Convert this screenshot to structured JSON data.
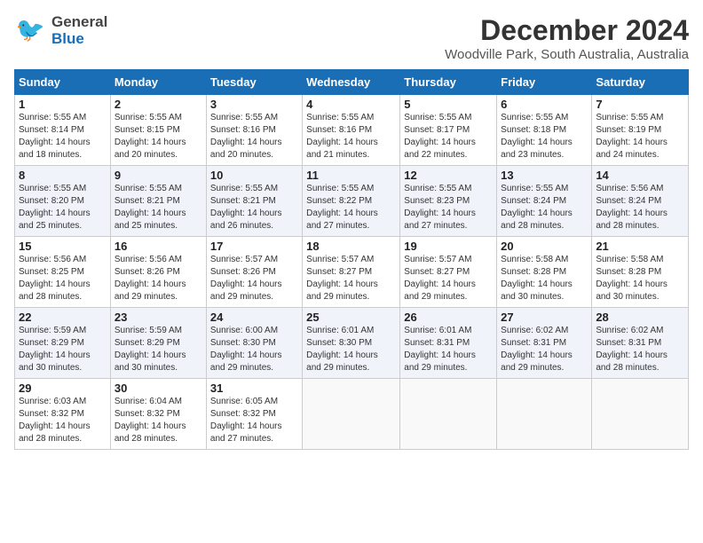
{
  "header": {
    "logo_general": "General",
    "logo_blue": "Blue",
    "title": "December 2024",
    "subtitle": "Woodville Park, South Australia, Australia"
  },
  "calendar": {
    "days_of_week": [
      "Sunday",
      "Monday",
      "Tuesday",
      "Wednesday",
      "Thursday",
      "Friday",
      "Saturday"
    ],
    "weeks": [
      [
        {
          "day": "",
          "info": ""
        },
        {
          "day": "2",
          "info": "Sunrise: 5:55 AM\nSunset: 8:15 PM\nDaylight: 14 hours\nand 20 minutes."
        },
        {
          "day": "3",
          "info": "Sunrise: 5:55 AM\nSunset: 8:16 PM\nDaylight: 14 hours\nand 20 minutes."
        },
        {
          "day": "4",
          "info": "Sunrise: 5:55 AM\nSunset: 8:16 PM\nDaylight: 14 hours\nand 21 minutes."
        },
        {
          "day": "5",
          "info": "Sunrise: 5:55 AM\nSunset: 8:17 PM\nDaylight: 14 hours\nand 22 minutes."
        },
        {
          "day": "6",
          "info": "Sunrise: 5:55 AM\nSunset: 8:18 PM\nDaylight: 14 hours\nand 23 minutes."
        },
        {
          "day": "7",
          "info": "Sunrise: 5:55 AM\nSunset: 8:19 PM\nDaylight: 14 hours\nand 24 minutes."
        }
      ],
      [
        {
          "day": "1",
          "info": "Sunrise: 5:55 AM\nSunset: 8:14 PM\nDaylight: 14 hours\nand 18 minutes."
        },
        {
          "day": "",
          "info": ""
        },
        {
          "day": "",
          "info": ""
        },
        {
          "day": "",
          "info": ""
        },
        {
          "day": "",
          "info": ""
        },
        {
          "day": "",
          "info": ""
        },
        {
          "day": "",
          "info": ""
        }
      ],
      [
        {
          "day": "8",
          "info": "Sunrise: 5:55 AM\nSunset: 8:20 PM\nDaylight: 14 hours\nand 25 minutes."
        },
        {
          "day": "9",
          "info": "Sunrise: 5:55 AM\nSunset: 8:21 PM\nDaylight: 14 hours\nand 25 minutes."
        },
        {
          "day": "10",
          "info": "Sunrise: 5:55 AM\nSunset: 8:21 PM\nDaylight: 14 hours\nand 26 minutes."
        },
        {
          "day": "11",
          "info": "Sunrise: 5:55 AM\nSunset: 8:22 PM\nDaylight: 14 hours\nand 27 minutes."
        },
        {
          "day": "12",
          "info": "Sunrise: 5:55 AM\nSunset: 8:23 PM\nDaylight: 14 hours\nand 27 minutes."
        },
        {
          "day": "13",
          "info": "Sunrise: 5:55 AM\nSunset: 8:24 PM\nDaylight: 14 hours\nand 28 minutes."
        },
        {
          "day": "14",
          "info": "Sunrise: 5:56 AM\nSunset: 8:24 PM\nDaylight: 14 hours\nand 28 minutes."
        }
      ],
      [
        {
          "day": "15",
          "info": "Sunrise: 5:56 AM\nSunset: 8:25 PM\nDaylight: 14 hours\nand 28 minutes."
        },
        {
          "day": "16",
          "info": "Sunrise: 5:56 AM\nSunset: 8:26 PM\nDaylight: 14 hours\nand 29 minutes."
        },
        {
          "day": "17",
          "info": "Sunrise: 5:57 AM\nSunset: 8:26 PM\nDaylight: 14 hours\nand 29 minutes."
        },
        {
          "day": "18",
          "info": "Sunrise: 5:57 AM\nSunset: 8:27 PM\nDaylight: 14 hours\nand 29 minutes."
        },
        {
          "day": "19",
          "info": "Sunrise: 5:57 AM\nSunset: 8:27 PM\nDaylight: 14 hours\nand 29 minutes."
        },
        {
          "day": "20",
          "info": "Sunrise: 5:58 AM\nSunset: 8:28 PM\nDaylight: 14 hours\nand 30 minutes."
        },
        {
          "day": "21",
          "info": "Sunrise: 5:58 AM\nSunset: 8:28 PM\nDaylight: 14 hours\nand 30 minutes."
        }
      ],
      [
        {
          "day": "22",
          "info": "Sunrise: 5:59 AM\nSunset: 8:29 PM\nDaylight: 14 hours\nand 30 minutes."
        },
        {
          "day": "23",
          "info": "Sunrise: 5:59 AM\nSunset: 8:29 PM\nDaylight: 14 hours\nand 30 minutes."
        },
        {
          "day": "24",
          "info": "Sunrise: 6:00 AM\nSunset: 8:30 PM\nDaylight: 14 hours\nand 29 minutes."
        },
        {
          "day": "25",
          "info": "Sunrise: 6:01 AM\nSunset: 8:30 PM\nDaylight: 14 hours\nand 29 minutes."
        },
        {
          "day": "26",
          "info": "Sunrise: 6:01 AM\nSunset: 8:31 PM\nDaylight: 14 hours\nand 29 minutes."
        },
        {
          "day": "27",
          "info": "Sunrise: 6:02 AM\nSunset: 8:31 PM\nDaylight: 14 hours\nand 29 minutes."
        },
        {
          "day": "28",
          "info": "Sunrise: 6:02 AM\nSunset: 8:31 PM\nDaylight: 14 hours\nand 28 minutes."
        }
      ],
      [
        {
          "day": "29",
          "info": "Sunrise: 6:03 AM\nSunset: 8:32 PM\nDaylight: 14 hours\nand 28 minutes."
        },
        {
          "day": "30",
          "info": "Sunrise: 6:04 AM\nSunset: 8:32 PM\nDaylight: 14 hours\nand 28 minutes."
        },
        {
          "day": "31",
          "info": "Sunrise: 6:05 AM\nSunset: 8:32 PM\nDaylight: 14 hours\nand 27 minutes."
        },
        {
          "day": "",
          "info": ""
        },
        {
          "day": "",
          "info": ""
        },
        {
          "day": "",
          "info": ""
        },
        {
          "day": "",
          "info": ""
        }
      ]
    ]
  }
}
